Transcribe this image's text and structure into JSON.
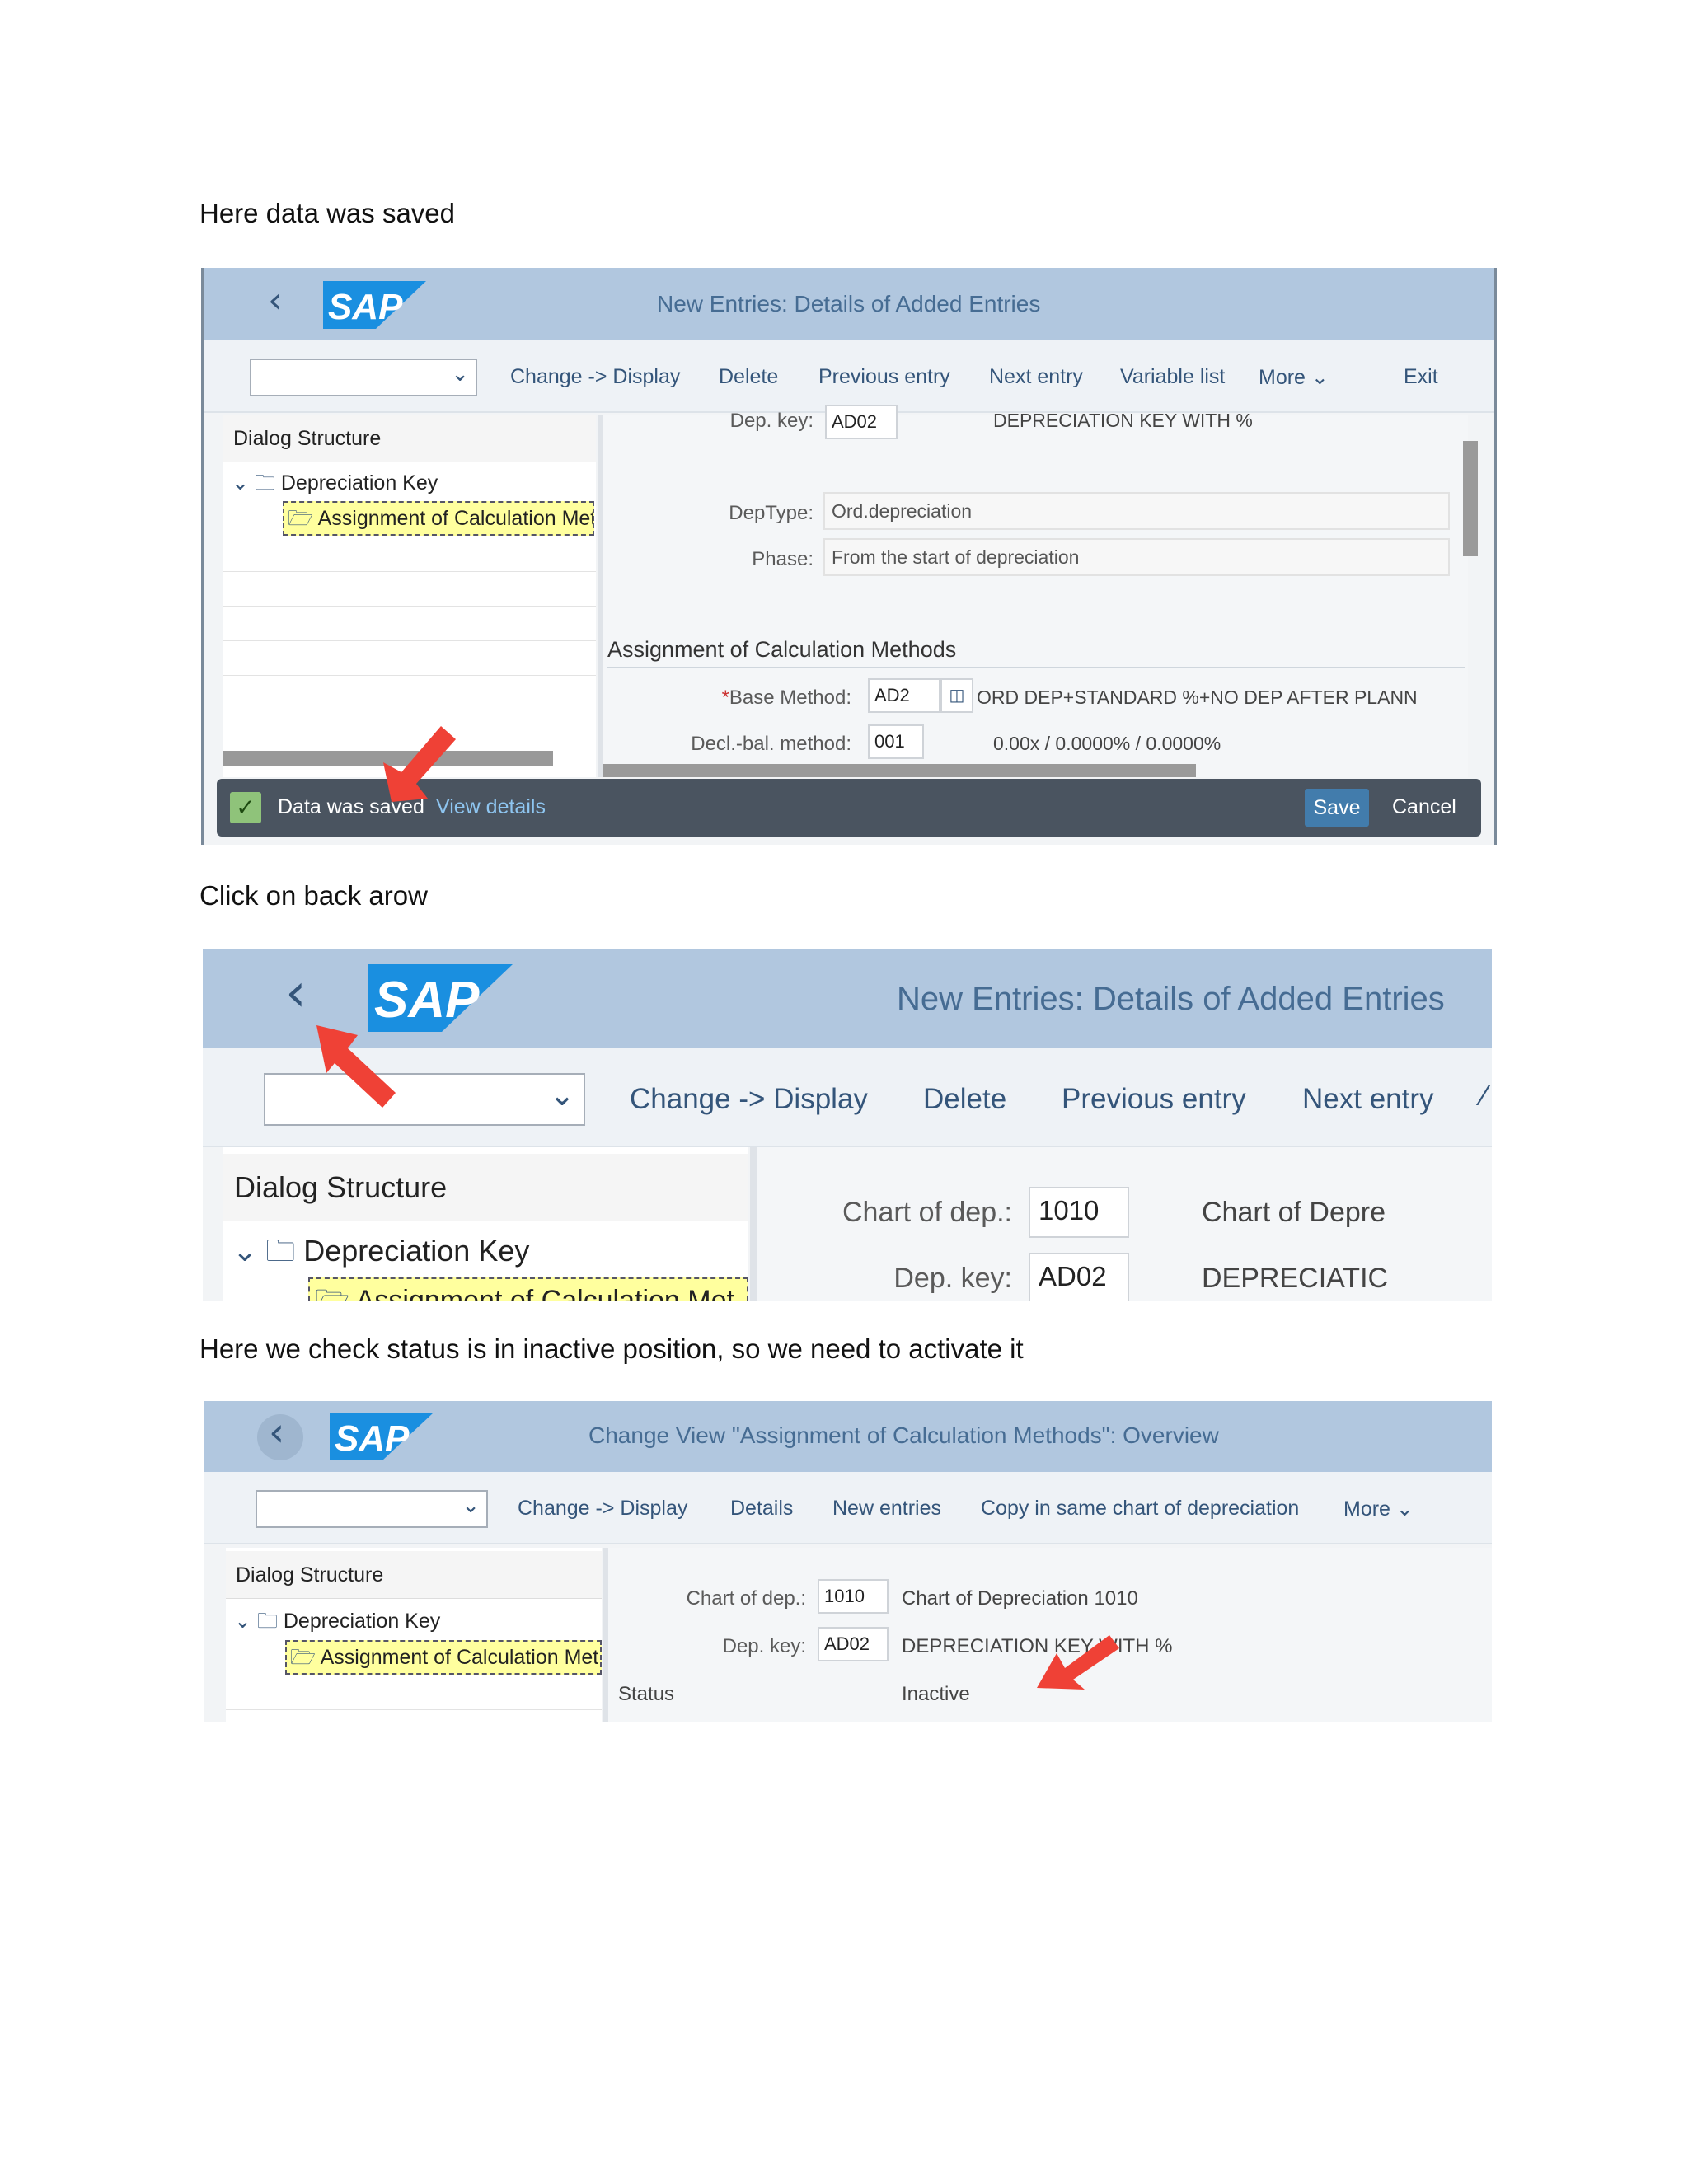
{
  "captions": {
    "c1": "Here data was saved",
    "c2": "Click on back arow",
    "c3": "Here we check status is in inactive position, so we need to activate it"
  },
  "colors": {
    "header": "#b1c7df",
    "link": "#34557a",
    "selected_tree": "#ffff9e",
    "save_button": "#427cac",
    "message_bar": "#4a5460",
    "arrow": "#ef4136"
  },
  "shot1": {
    "logo": "SAP",
    "title": "New Entries: Details of Added Entries",
    "toolbar": [
      "Change -> Display",
      "Delete",
      "Previous entry",
      "Next entry",
      "Variable list",
      "More",
      "Exit"
    ],
    "dialog_structure": "Dialog Structure",
    "tree_parent": "Depreciation Key",
    "tree_child": "Assignment of Calculation Met",
    "dep_key_label": "Dep. key:",
    "dep_key_value": "AD02",
    "dep_key_desc": "DEPRECIATION KEY WITH %",
    "deptype_label": "DepType:",
    "deptype_value": "Ord.depreciation",
    "phase_label": "Phase:",
    "phase_value": "From the start of depreciation",
    "section_title": "Assignment of Calculation Methods",
    "base_method_required": "*",
    "base_method_label": "Base Method:",
    "base_method_value": "AD2",
    "base_method_desc": "ORD DEP+STANDARD %+NO DEP AFTER PLANN",
    "decl_label": "Decl.-bal. method:",
    "decl_value": "001",
    "decl_desc": "0.00x / 0.0000% / 0.0000%",
    "message": "Data was saved",
    "view_details": "View details",
    "save": "Save",
    "cancel": "Cancel"
  },
  "shot2": {
    "logo": "SAP",
    "title": "New Entries: Details of Added Entries",
    "toolbar": [
      "Change -> Display",
      "Delete",
      "Previous entry",
      "Next entry"
    ],
    "dialog_structure": "Dialog Structure",
    "tree_parent": "Depreciation Key",
    "tree_child": "Assignment of Calculation Met",
    "chart_label": "Chart of dep.:",
    "chart_value": "1010",
    "chart_desc": "Chart of Depre",
    "dep_key_label": "Dep. key:",
    "dep_key_value": "AD02",
    "dep_key_desc": "DEPRECIATIC"
  },
  "shot3": {
    "logo": "SAP",
    "title": "Change View \"Assignment of Calculation Methods\": Overview",
    "toolbar": [
      "Change -> Display",
      "Details",
      "New entries",
      "Copy in same chart of depreciation",
      "More"
    ],
    "dialog_structure": "Dialog Structure",
    "tree_parent": "Depreciation Key",
    "tree_child": "Assignment of Calculation Met",
    "chart_label": "Chart of dep.:",
    "chart_value": "1010",
    "chart_desc": "Chart of Depreciation 1010",
    "dep_key_label": "Dep. key:",
    "dep_key_value": "AD02",
    "dep_key_desc": "DEPRECIATION KEY WITH %",
    "status_label": "Status",
    "status_value": "Inactive"
  }
}
